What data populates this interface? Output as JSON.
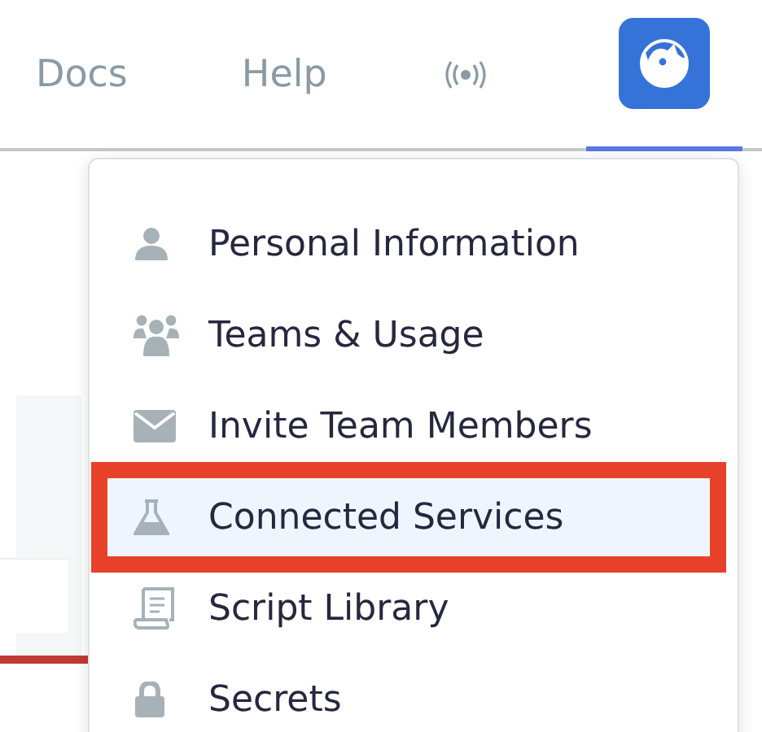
{
  "nav": {
    "links": [
      {
        "label": "Docs",
        "selected": false
      },
      {
        "label": "Help",
        "selected": false
      }
    ],
    "avatar": {
      "selected": true
    }
  },
  "menu": {
    "items": [
      {
        "label": "Personal Information",
        "selected": false
      },
      {
        "label": "Teams & Usage",
        "selected": false
      },
      {
        "label": "Invite Team Members",
        "selected": false
      },
      {
        "label": "Connected Services",
        "selected": true
      },
      {
        "label": "Script Library",
        "selected": false
      },
      {
        "label": "Secrets",
        "selected": false
      }
    ]
  }
}
